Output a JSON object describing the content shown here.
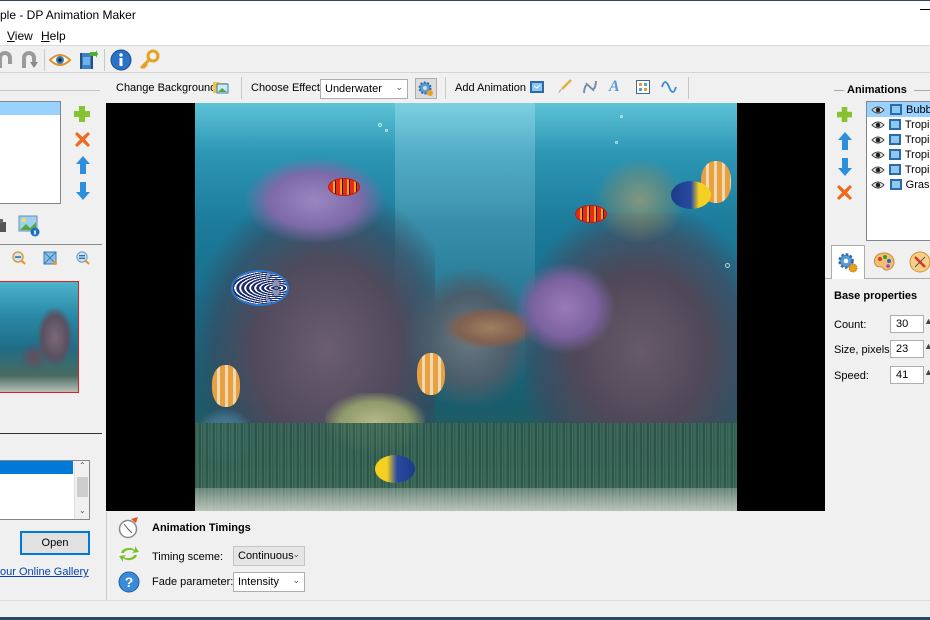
{
  "window": {
    "title": "ple - DP Animation Maker"
  },
  "menu": {
    "items": [
      {
        "label": "View",
        "accel": "V"
      },
      {
        "label": "Help",
        "accel": "H"
      }
    ]
  },
  "toolbar": {
    "icons": [
      "undo-icon",
      "redo-icon",
      "preview-eye-icon",
      "export-video-icon",
      "info-icon",
      "key-icon"
    ]
  },
  "toolbar2": {
    "change_background_label": "Change Background",
    "choose_effect_label": "Choose Effect:",
    "effect_value": "Underwater",
    "add_animation_label": "Add Animation",
    "animation_tools": [
      "video-clip-icon",
      "brush-icon",
      "path-icon",
      "text-icon",
      "sprite-grid-icon",
      "wave-icon"
    ]
  },
  "left_panel": {
    "scenes_list": [
      ""
    ],
    "gallery_list": [
      "",
      ""
    ],
    "open_button": "Open",
    "gallery_link": "our Online Gallery"
  },
  "timings": {
    "title": "Animation Timings",
    "timing_scheme_label": "Timing sceme:",
    "timing_scheme_value": "Continuous",
    "fade_parameter_label": "Fade parameter:",
    "fade_parameter_value": "Intensity"
  },
  "animations_panel": {
    "title": "Animations",
    "items": [
      {
        "label": "Bubbl",
        "selected": true
      },
      {
        "label": "Tropic",
        "selected": false
      },
      {
        "label": "Tropic",
        "selected": false
      },
      {
        "label": "Tropic",
        "selected": false
      },
      {
        "label": "Tropic",
        "selected": false
      },
      {
        "label": "Grass",
        "selected": false
      }
    ]
  },
  "properties": {
    "section_title": "Base properties",
    "fields": [
      {
        "label": "Count:",
        "value": "30"
      },
      {
        "label": "Size, pixels:",
        "value": "23"
      },
      {
        "label": "Speed:",
        "value": "41"
      }
    ]
  },
  "colors": {
    "accent": "#0078d7",
    "selection": "#99d1ff",
    "selection_strong": "#0078d7",
    "thumbnail_border": "#e02020",
    "link": "#0645ad"
  }
}
